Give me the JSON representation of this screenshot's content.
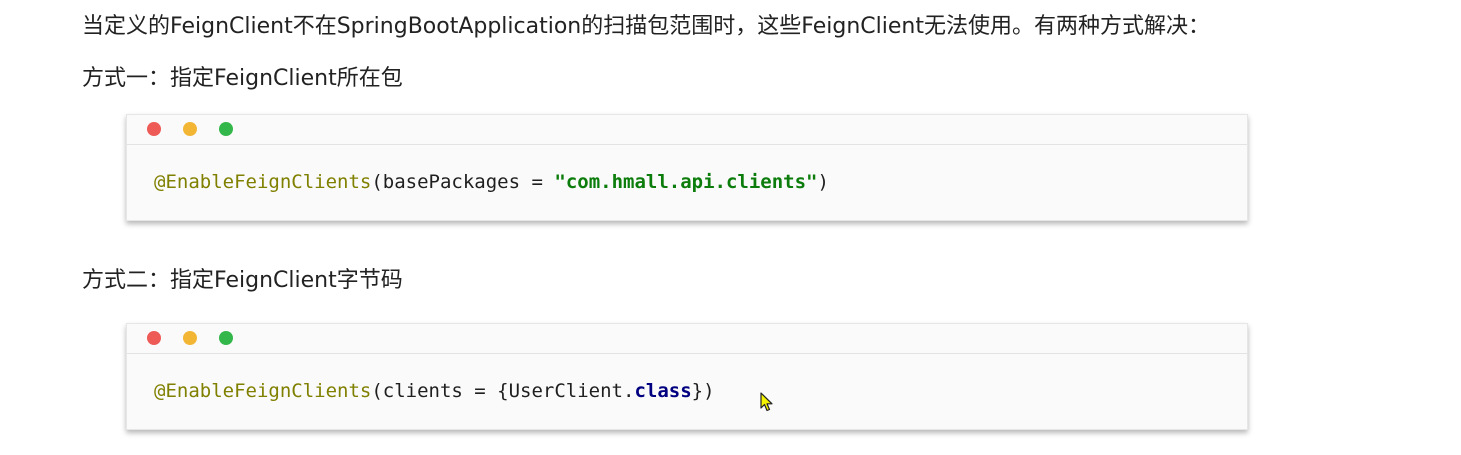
{
  "intro": "当定义的FeignClient不在SpringBootApplication的扫描包范围时，这些FeignClient无法使用。有两种方式解决：",
  "method1": {
    "heading": "方式一：指定FeignClient所在包",
    "code": {
      "annotation": "@EnableFeignClients",
      "open": "(basePackages = ",
      "string": "\"com.hmall.api.clients\"",
      "close": ")"
    }
  },
  "method2": {
    "heading": "方式二：指定FeignClient字节码",
    "code": {
      "annotation": "@EnableFeignClients",
      "open": "(clients = {UserClient.",
      "keyword": "class",
      "close": "})"
    }
  },
  "window_controls": [
    "close",
    "minimize",
    "maximize"
  ],
  "colors": {
    "annotation": "#808000",
    "string": "#0c7d0c",
    "keyword": "#000080",
    "close_dot": "#ee5a56",
    "minimize_dot": "#f2b634",
    "maximize_dot": "#34b74a"
  }
}
